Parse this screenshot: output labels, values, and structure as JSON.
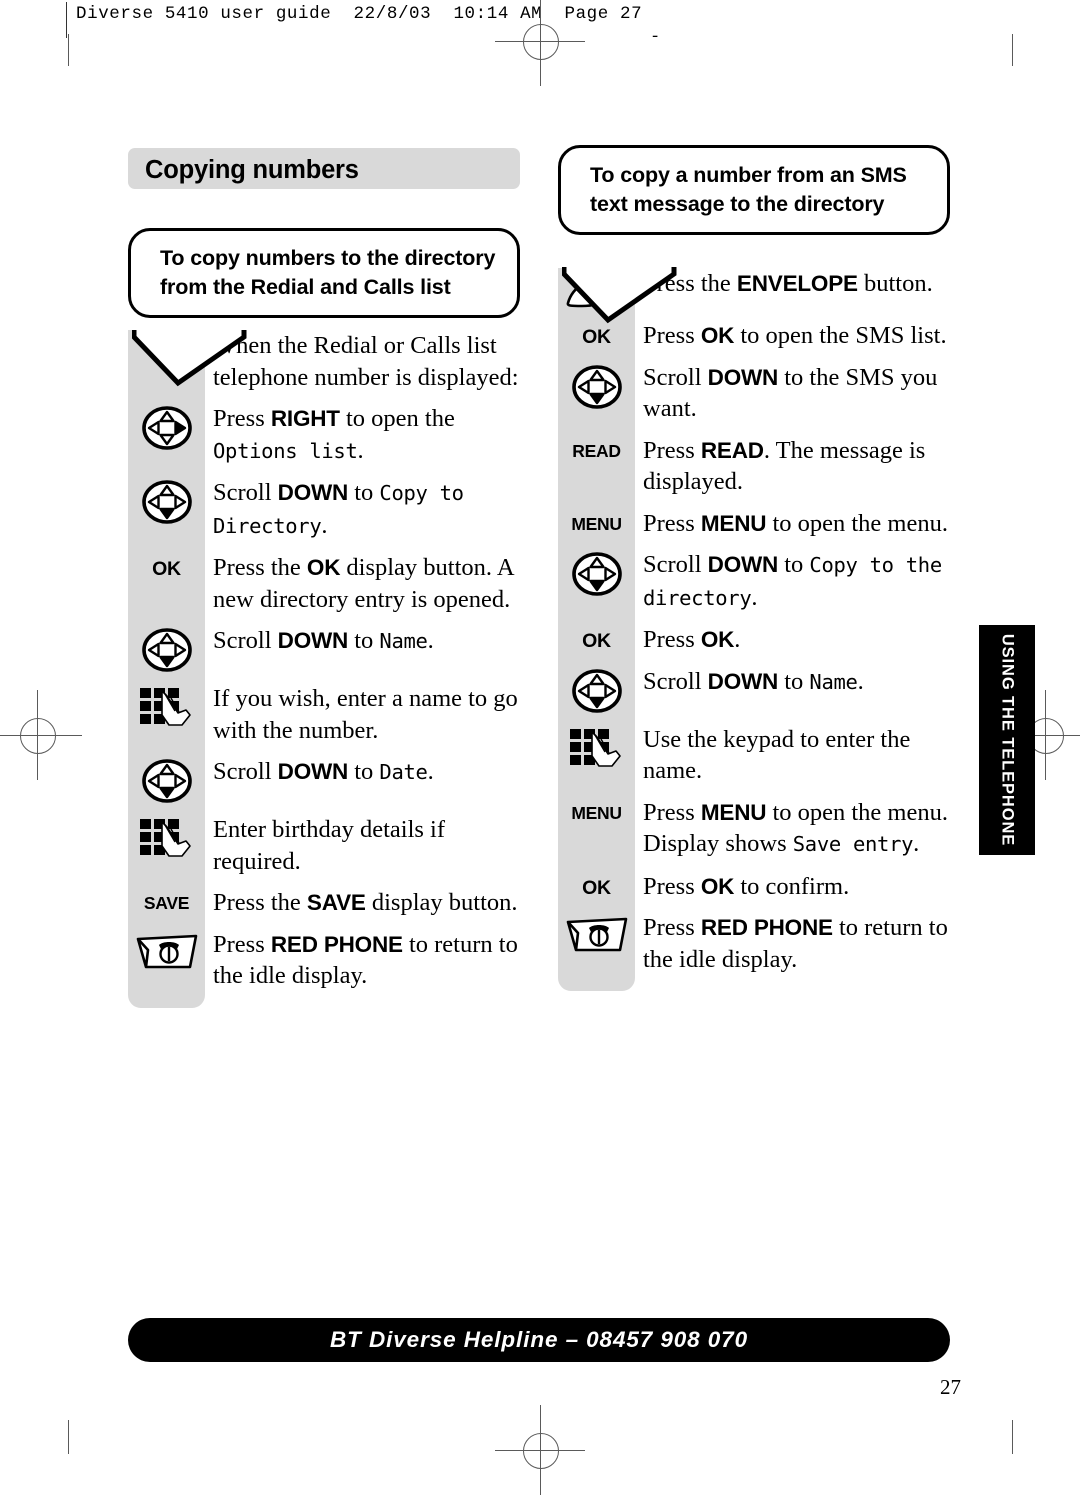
{
  "print_slug": "Diverse 5410 user guide  22/8/03  10:14 AM  Page 27",
  "slug_dash": "-",
  "page_title": "Copying numbers",
  "page_number": "27",
  "side_tab": "USING THE TELEPHONE",
  "footer": "BT Diverse Helpline – 08457 908 070",
  "left_column": {
    "heading": "To copy numbers to the directory from the Redial and Calls list",
    "steps": [
      {
        "icon": "none",
        "icon_label": "",
        "parts": [
          {
            "t": "plain",
            "v": "When the Redial or Calls list telephone number is displayed:"
          }
        ]
      },
      {
        "icon": "nav-right",
        "icon_label": "",
        "parts": [
          {
            "t": "plain",
            "v": "Press "
          },
          {
            "t": "key",
            "v": "RIGHT"
          },
          {
            "t": "plain",
            "v": " to open the "
          },
          {
            "t": "lcd",
            "v": "Options list"
          },
          {
            "t": "plain",
            "v": "."
          }
        ]
      },
      {
        "icon": "nav-down",
        "icon_label": "",
        "parts": [
          {
            "t": "plain",
            "v": "Scroll "
          },
          {
            "t": "key",
            "v": "DOWN"
          },
          {
            "t": "plain",
            "v": " to "
          },
          {
            "t": "lcd",
            "v": "Copy to Directory"
          },
          {
            "t": "plain",
            "v": "."
          }
        ]
      },
      {
        "icon": "label",
        "icon_label": "OK",
        "parts": [
          {
            "t": "plain",
            "v": "Press the "
          },
          {
            "t": "key",
            "v": "OK"
          },
          {
            "t": "plain",
            "v": " display button. A new directory entry is opened."
          }
        ]
      },
      {
        "icon": "nav-down",
        "icon_label": "",
        "parts": [
          {
            "t": "plain",
            "v": "Scroll "
          },
          {
            "t": "key",
            "v": "DOWN"
          },
          {
            "t": "plain",
            "v": " to "
          },
          {
            "t": "lcd",
            "v": "Name"
          },
          {
            "t": "plain",
            "v": "."
          }
        ]
      },
      {
        "icon": "keypad",
        "icon_label": "",
        "parts": [
          {
            "t": "plain",
            "v": "If you wish, enter a name to go with the number."
          }
        ]
      },
      {
        "icon": "nav-down",
        "icon_label": "",
        "parts": [
          {
            "t": "plain",
            "v": "Scroll "
          },
          {
            "t": "key",
            "v": "DOWN"
          },
          {
            "t": "plain",
            "v": " to "
          },
          {
            "t": "lcd",
            "v": "Date"
          },
          {
            "t": "plain",
            "v": "."
          }
        ]
      },
      {
        "icon": "keypad",
        "icon_label": "",
        "parts": [
          {
            "t": "plain",
            "v": "Enter birthday details if required."
          }
        ]
      },
      {
        "icon": "label",
        "icon_label": "SAVE",
        "parts": [
          {
            "t": "plain",
            "v": "Press the "
          },
          {
            "t": "key",
            "v": "SAVE"
          },
          {
            "t": "plain",
            "v": " display button."
          }
        ]
      },
      {
        "icon": "red-phone",
        "icon_label": "",
        "parts": [
          {
            "t": "plain",
            "v": "Press "
          },
          {
            "t": "key",
            "v": "RED PHONE"
          },
          {
            "t": "plain",
            "v": " to return to the idle display."
          }
        ]
      }
    ]
  },
  "right_column": {
    "heading": "To copy a number from an SMS text message to the directory",
    "steps": [
      {
        "icon": "envelope",
        "icon_label": "",
        "parts": [
          {
            "t": "plain",
            "v": "Press the "
          },
          {
            "t": "key",
            "v": "ENVELOPE"
          },
          {
            "t": "plain",
            "v": " button."
          }
        ]
      },
      {
        "icon": "label",
        "icon_label": "OK",
        "parts": [
          {
            "t": "plain",
            "v": "Press "
          },
          {
            "t": "key",
            "v": "OK"
          },
          {
            "t": "plain",
            "v": " to open the SMS list."
          }
        ]
      },
      {
        "icon": "nav-down",
        "icon_label": "",
        "parts": [
          {
            "t": "plain",
            "v": "Scroll "
          },
          {
            "t": "key",
            "v": "DOWN"
          },
          {
            "t": "plain",
            "v": " to the SMS you want."
          }
        ]
      },
      {
        "icon": "label",
        "icon_label": "READ",
        "parts": [
          {
            "t": "plain",
            "v": "Press "
          },
          {
            "t": "key",
            "v": "READ"
          },
          {
            "t": "plain",
            "v": ". The message is displayed."
          }
        ]
      },
      {
        "icon": "label",
        "icon_label": "MENU",
        "parts": [
          {
            "t": "plain",
            "v": "Press "
          },
          {
            "t": "key",
            "v": "MENU"
          },
          {
            "t": "plain",
            "v": " to open the menu."
          }
        ]
      },
      {
        "icon": "nav-down",
        "icon_label": "",
        "parts": [
          {
            "t": "plain",
            "v": "Scroll "
          },
          {
            "t": "key",
            "v": "DOWN"
          },
          {
            "t": "plain",
            "v": " to "
          },
          {
            "t": "lcd",
            "v": "Copy to the directory"
          },
          {
            "t": "plain",
            "v": "."
          }
        ]
      },
      {
        "icon": "label",
        "icon_label": "OK",
        "parts": [
          {
            "t": "plain",
            "v": "Press "
          },
          {
            "t": "key",
            "v": "OK"
          },
          {
            "t": "plain",
            "v": "."
          }
        ]
      },
      {
        "icon": "nav-down",
        "icon_label": "",
        "parts": [
          {
            "t": "plain",
            "v": "Scroll "
          },
          {
            "t": "key",
            "v": "DOWN"
          },
          {
            "t": "plain",
            "v": " to "
          },
          {
            "t": "lcd",
            "v": "Name"
          },
          {
            "t": "plain",
            "v": "."
          }
        ]
      },
      {
        "icon": "keypad",
        "icon_label": "",
        "parts": [
          {
            "t": "plain",
            "v": "Use the keypad to enter the name."
          }
        ]
      },
      {
        "icon": "label",
        "icon_label": "MENU",
        "parts": [
          {
            "t": "plain",
            "v": "Press "
          },
          {
            "t": "key",
            "v": "MENU"
          },
          {
            "t": "plain",
            "v": " to open the menu. Display shows "
          },
          {
            "t": "lcd",
            "v": "Save entry"
          },
          {
            "t": "plain",
            "v": "."
          }
        ]
      },
      {
        "icon": "label",
        "icon_label": "OK",
        "parts": [
          {
            "t": "plain",
            "v": "Press "
          },
          {
            "t": "key",
            "v": "OK"
          },
          {
            "t": "plain",
            "v": " to confirm."
          }
        ]
      },
      {
        "icon": "red-phone",
        "icon_label": "",
        "parts": [
          {
            "t": "plain",
            "v": "Press "
          },
          {
            "t": "key",
            "v": "RED PHONE"
          },
          {
            "t": "plain",
            "v": " to return to the idle display."
          }
        ]
      }
    ]
  },
  "colors": {
    "gray_panel": "#d9d9d9",
    "ink": "#000000",
    "paper": "#ffffff"
  }
}
